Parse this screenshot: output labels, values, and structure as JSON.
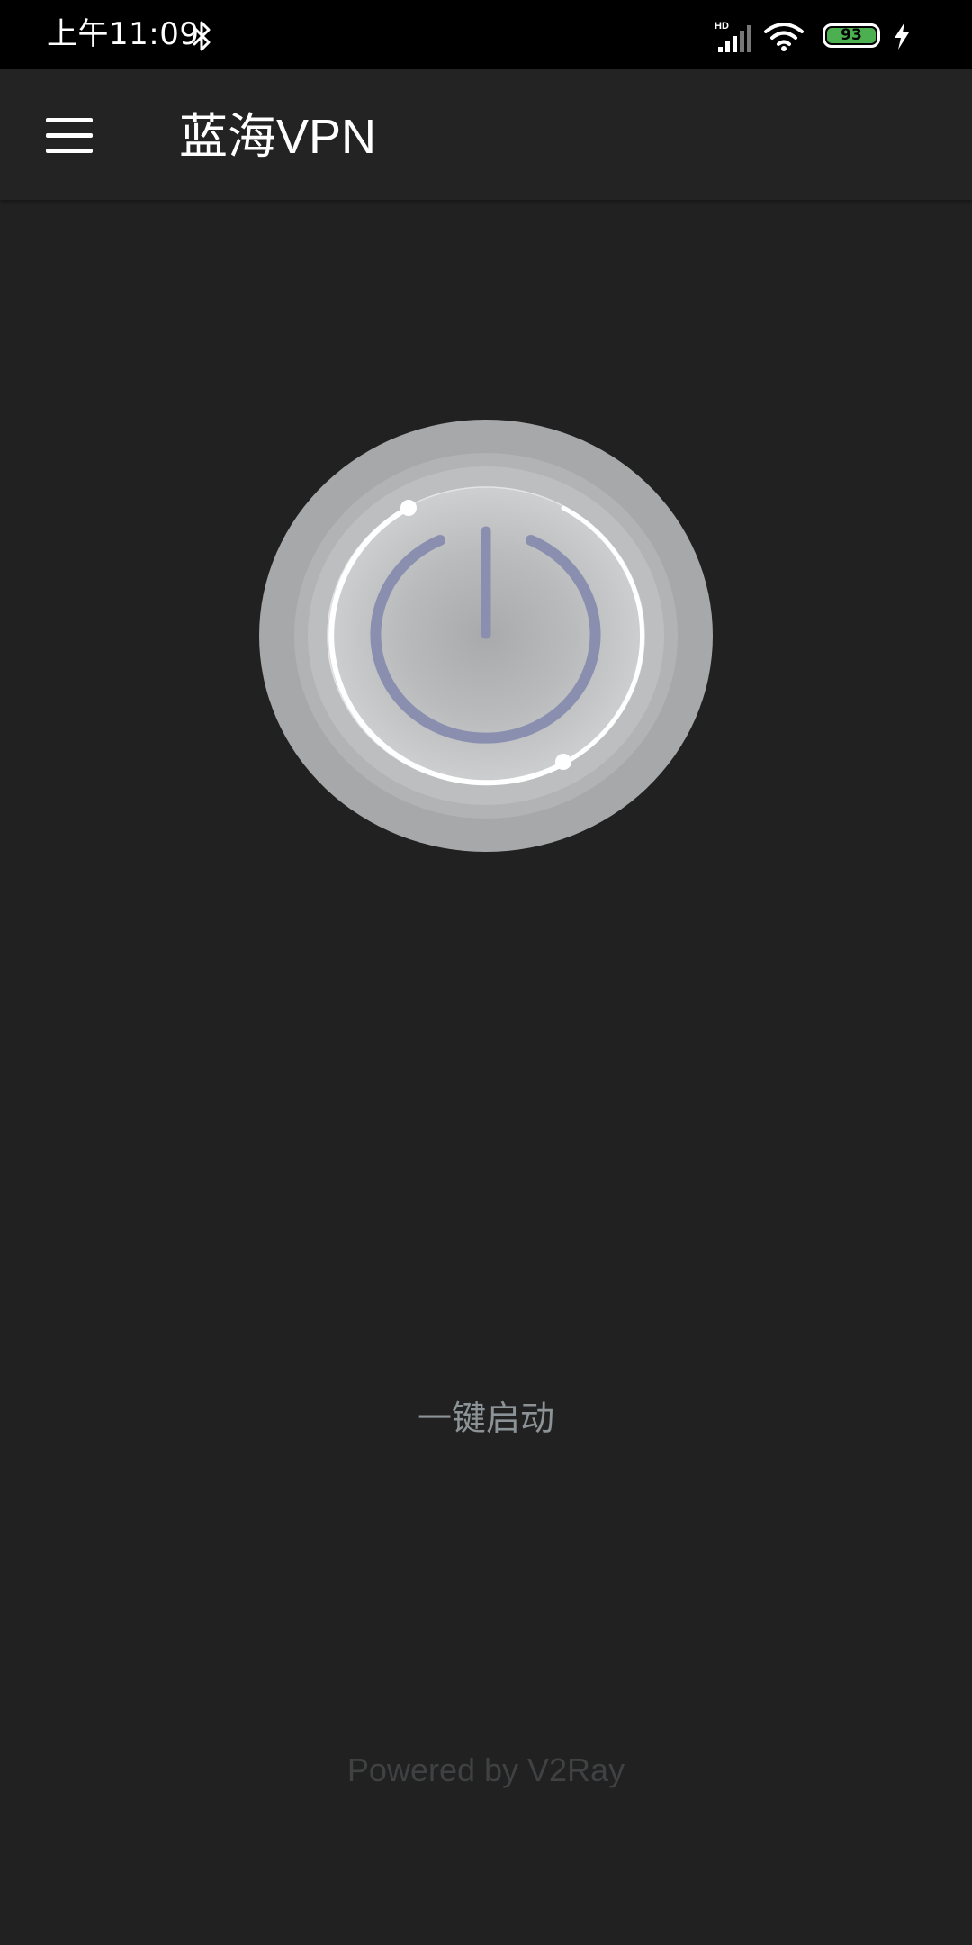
{
  "status_bar": {
    "time": "上午11:09",
    "network": "HD",
    "battery": "93"
  },
  "app_bar": {
    "title": "蓝海VPN"
  },
  "main": {
    "start_label": "一键启动"
  },
  "footer": {
    "powered_by": "Powered by V2Ray"
  },
  "colors": {
    "background": "#212121",
    "status_bar": "#000000",
    "power_icon": "#8a8fb0",
    "label": "#8c9396",
    "battery": "#4caf50"
  }
}
